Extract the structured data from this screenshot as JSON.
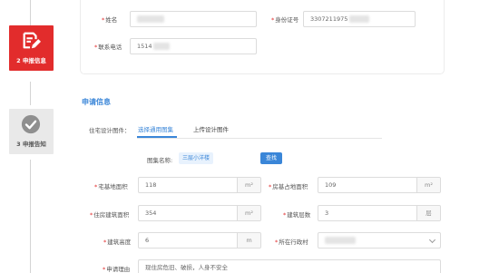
{
  "steps": [
    {
      "label": "2 申报信息",
      "icon": "edit-icon",
      "state": "active",
      "color": "#e22c2c"
    },
    {
      "label": "3 申报告知",
      "icon": "check-icon",
      "state": "inactive",
      "color": "#e9e9e9"
    }
  ],
  "personal": {
    "name_label": "姓名",
    "id_label": "身份证号",
    "id_value": "3307211975",
    "phone_label": "联系电话",
    "phone_value": "1514"
  },
  "section_title": "申请信息",
  "design": {
    "label": "住宅设计图件：",
    "tab_select": "选择通用图集",
    "tab_upload": "上传设计图件",
    "atlas_label": "图集名称:",
    "atlas_value": "三层小洋楼",
    "search_button": "查找"
  },
  "form": {
    "base_area_label": "宅基地面积",
    "base_area_value": "118",
    "base_area_unit": "m²",
    "house_area_label": "房基占地面积",
    "house_area_value": "109",
    "house_area_unit": "m²",
    "build_area_label": "住房建筑面积",
    "build_area_value": "354",
    "build_area_unit": "m²",
    "floors_label": "建筑层数",
    "floors_value": "3",
    "floors_unit": "层",
    "height_label": "建筑高度",
    "height_value": "6",
    "height_unit": "m",
    "village_label": "所在行政村",
    "reason_label": "申请理由",
    "reason_value": "现住房危旧、破损，人身不安全"
  },
  "colors": {
    "accent": "#3a86d8",
    "brand_red": "#e22c2c",
    "required": "#e22c2c"
  }
}
